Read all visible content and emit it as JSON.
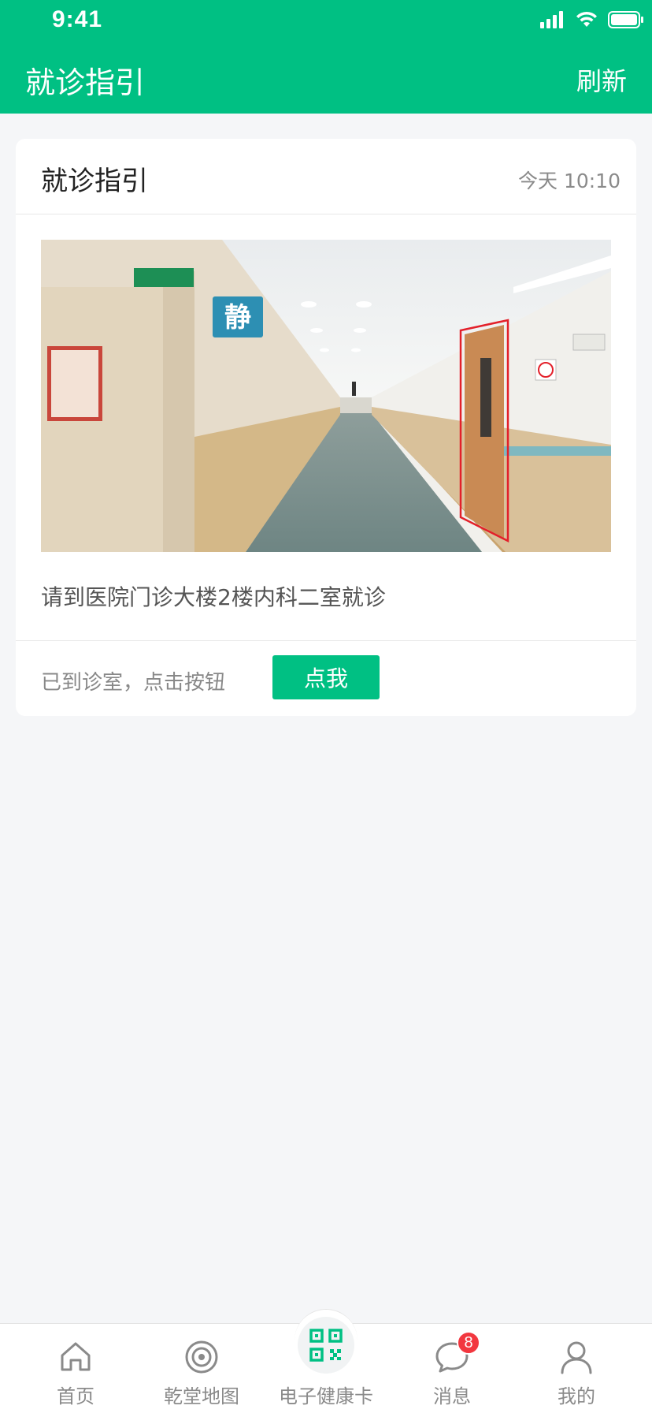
{
  "status_bar": {
    "time": "9:41"
  },
  "navbar": {
    "title": "就诊指引",
    "refresh_label": "刷新"
  },
  "card": {
    "title": "就诊指引",
    "time": "今天 10:10",
    "guide_text": "请到医院门诊大楼2楼内科二室就诊",
    "photo_sign_text": "静",
    "footer_hint": "已到诊室，点击按钮",
    "button_label": "点我"
  },
  "tabbar": {
    "items": [
      {
        "label": "首页",
        "icon": "home-icon"
      },
      {
        "label": "乾堂地图",
        "icon": "map-target-icon"
      },
      {
        "label": "电子健康卡",
        "icon": "qr-code-icon"
      },
      {
        "label": "消息",
        "icon": "message-bubble-icon",
        "badge": "8"
      },
      {
        "label": "我的",
        "icon": "user-icon"
      }
    ]
  },
  "colors": {
    "primary": "#00c083",
    "badge": "#f2373f"
  }
}
